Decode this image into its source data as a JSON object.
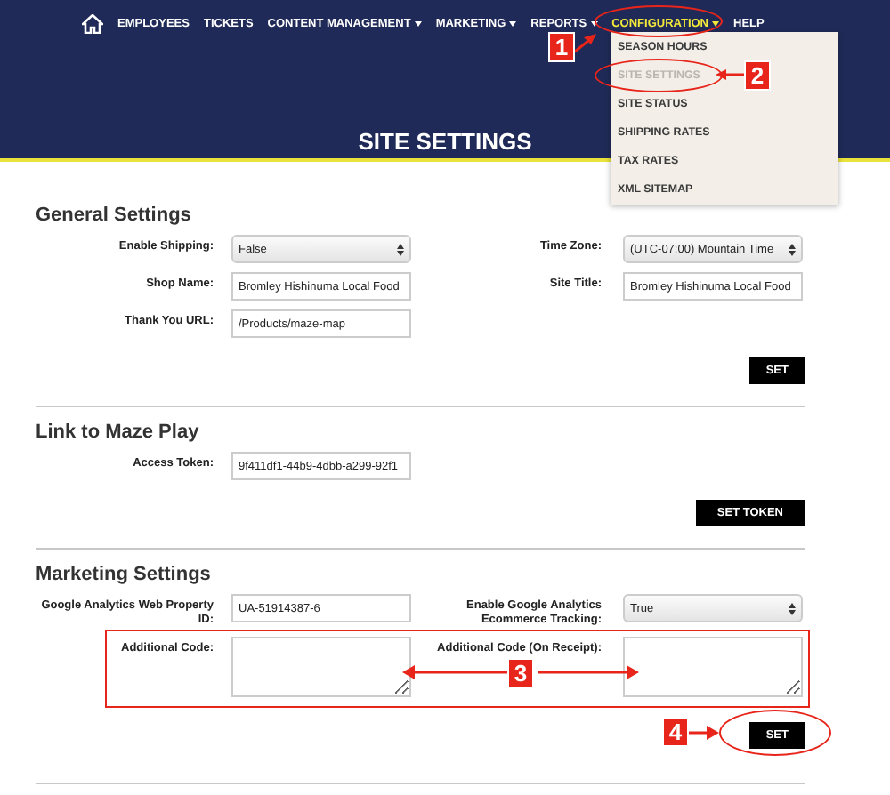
{
  "nav": {
    "items": [
      {
        "label": "EMPLOYEES",
        "has_menu": false,
        "selected": false
      },
      {
        "label": "TICKETS",
        "has_menu": false,
        "selected": false
      },
      {
        "label": "CONTENT MANAGEMENT",
        "has_menu": true,
        "selected": false
      },
      {
        "label": "MARKETING",
        "has_menu": true,
        "selected": false
      },
      {
        "label": "REPORTS",
        "has_menu": true,
        "selected": false
      },
      {
        "label": "CONFIGURATION",
        "has_menu": true,
        "selected": true
      },
      {
        "label": "HELP",
        "has_menu": false,
        "selected": false
      }
    ]
  },
  "dropdown": {
    "items": [
      {
        "label": "SEASON HOURS",
        "selected": false
      },
      {
        "label": "SITE SETTINGS",
        "selected": true
      },
      {
        "label": "SITE STATUS",
        "selected": false
      },
      {
        "label": "SHIPPING RATES",
        "selected": false
      },
      {
        "label": "TAX RATES",
        "selected": false
      },
      {
        "label": "XML SITEMAP",
        "selected": false
      }
    ]
  },
  "page_title": "SITE SETTINGS",
  "sections": [
    {
      "title": "General Settings",
      "button": "SET",
      "fields": [
        {
          "label": "Enable Shipping:",
          "kind": "select",
          "value": "False"
        },
        {
          "label": "Time Zone:",
          "kind": "select",
          "value": "(UTC-07:00) Mountain Time"
        },
        {
          "label": "Shop Name:",
          "kind": "text",
          "value": "Bromley Hishinuma Local Food"
        },
        {
          "label": "Site Title:",
          "kind": "text",
          "value": "Bromley Hishinuma Local Food"
        },
        {
          "label": "Thank You URL:",
          "kind": "text",
          "value": "/Products/maze-map"
        }
      ]
    },
    {
      "title": "Link to Maze Play",
      "button": "SET TOKEN",
      "fields": [
        {
          "label": "Access Token:",
          "kind": "text",
          "value": "9f411df1-44b9-4dbb-a299-92f1"
        }
      ]
    },
    {
      "title": "Marketing Settings",
      "button": "SET",
      "fields": [
        {
          "label": "Google Analytics Web Property ID:",
          "kind": "text",
          "value": "UA-51914387-6"
        },
        {
          "label": "Enable Google Analytics Ecommerce Tracking:",
          "kind": "select",
          "value": "True"
        },
        {
          "label": "Additional Code:",
          "kind": "textarea"
        },
        {
          "label": "Additional Code (On Receipt):",
          "kind": "textarea"
        }
      ]
    }
  ],
  "annotations": [
    "1",
    "2",
    "3",
    "4"
  ]
}
